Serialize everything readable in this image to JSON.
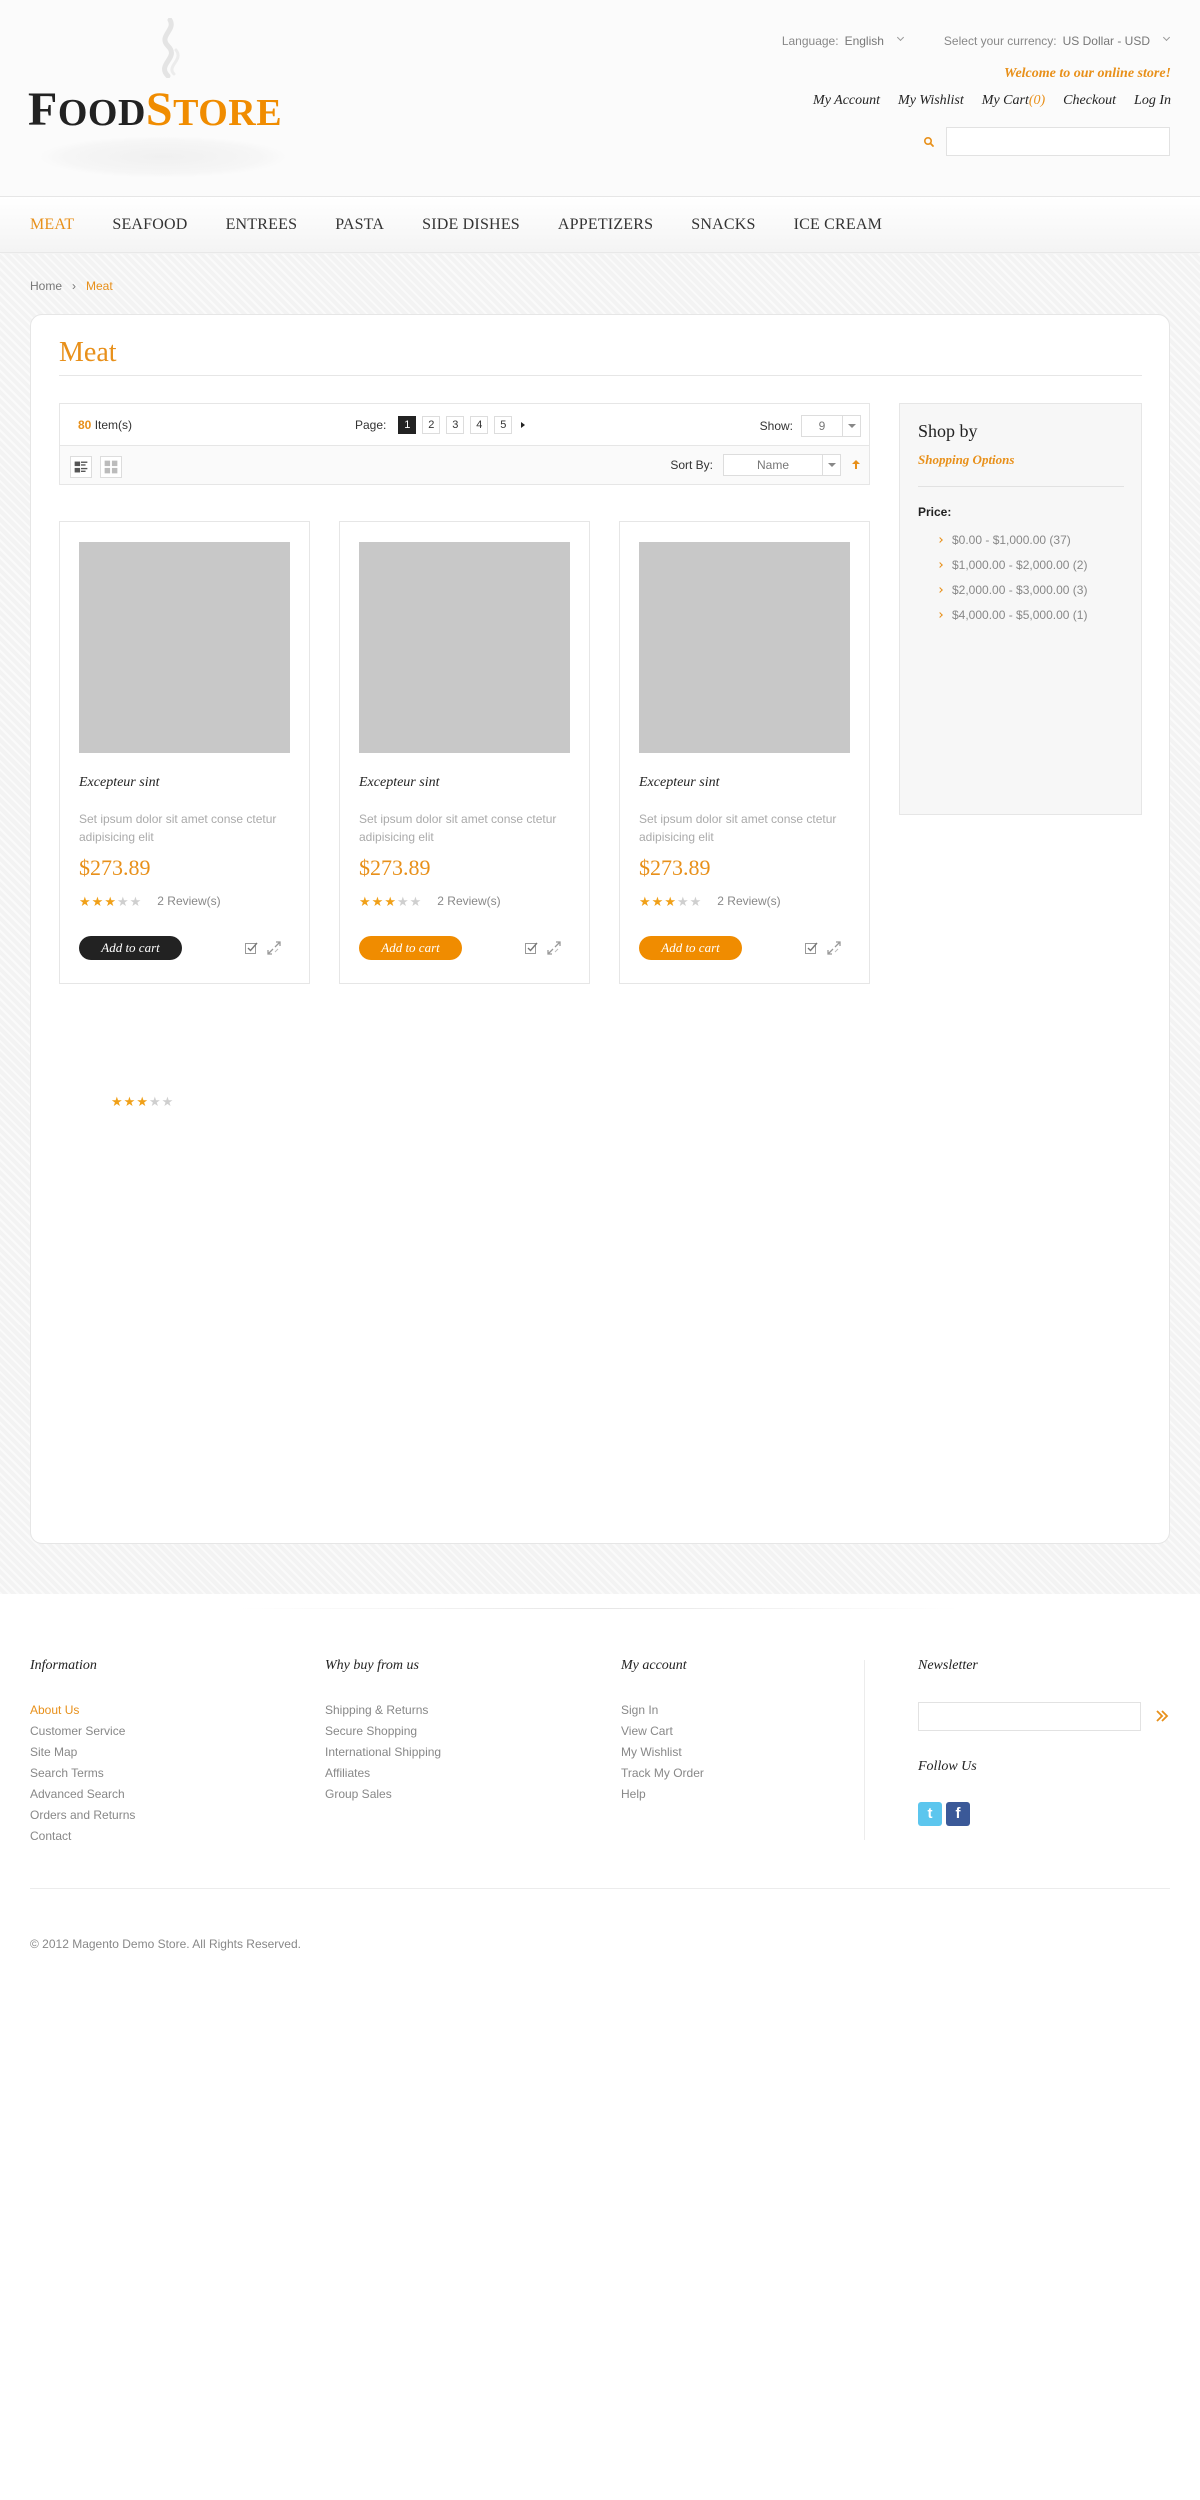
{
  "header": {
    "logo": {
      "text_a": "F",
      "text_b": "OOD",
      "text_c": "S",
      "text_d": "TORE"
    },
    "language": {
      "label": "Language:",
      "value": "English"
    },
    "currency": {
      "label": "Select your currency:",
      "value": "US Dollar - USD"
    },
    "welcome": "Welcome to our online store!",
    "links": {
      "account": "My Account",
      "wishlist": "My Wishlist",
      "cart": "My Cart",
      "cart_count": "(0)",
      "checkout": "Checkout",
      "login": "Log In"
    },
    "search": {
      "value": "",
      "placeholder": ""
    }
  },
  "nav": {
    "items": [
      "Meat",
      "Seafood",
      "Entrees",
      "Pasta",
      "Side Dishes",
      "Appetizers",
      "Snacks",
      "Ice cream"
    ]
  },
  "breadcrumb": {
    "home": "Home",
    "sep": "›",
    "current": "Meat"
  },
  "main": {
    "title": "Meat",
    "toolbar": {
      "count": "80",
      "count_label": "Item(s)",
      "page_label": "Page:",
      "pages": [
        "1",
        "2",
        "3",
        "4",
        "5"
      ],
      "current_page": "1",
      "show_label": "Show:",
      "show_value": "9",
      "sort_label": "Sort By:",
      "sort_value": "Name"
    },
    "products": [
      {
        "name": "Excepteur sint",
        "desc": "Set ipsum dolor sit amet conse ctetur adipisicing elit",
        "price": "$273.89",
        "rating": 3,
        "reviews": "2 Review(s)",
        "cart_label": "Add to cart",
        "cart_style": "dark"
      },
      {
        "name": "Excepteur sint",
        "desc": "Set ipsum dolor sit amet conse ctetur adipisicing elit",
        "price": "$273.89",
        "rating": 3,
        "reviews": "2 Review(s)",
        "cart_label": "Add to cart",
        "cart_style": "orange"
      },
      {
        "name": "Excepteur sint",
        "desc": "Set ipsum dolor sit amet conse ctetur adipisicing elit",
        "price": "$273.89",
        "rating": 3,
        "reviews": "2 Review(s)",
        "cart_label": "Add to cart",
        "cart_style": "orange"
      }
    ],
    "loose_rating": 3
  },
  "sidebar": {
    "heading": "Shop by",
    "subheading": "Shopping Options",
    "price_label": "Price:",
    "price_ranges": [
      "$0.00 - $1,000.00 (37)",
      "$1,000.00 - $2,000.00 (2)",
      "$2,000.00 - $3,000.00 (3)",
      "$4,000.00 - $5,000.00 (1)"
    ]
  },
  "footer": {
    "columns": [
      {
        "heading": "Information",
        "links": [
          "About Us",
          "Customer Service",
          "Site Map",
          "Search Terms",
          "Advanced Search",
          "Orders and Returns",
          "Contact"
        ],
        "highlight": 0
      },
      {
        "heading": "Why buy from us",
        "links": [
          "Shipping & Returns",
          "Secure Shopping",
          "International Shipping",
          "Affiliates",
          "Group Sales"
        ],
        "highlight": -1
      },
      {
        "heading": "My account",
        "links": [
          "Sign In",
          "View Cart",
          "My Wishlist",
          "Track My Order",
          "Help"
        ],
        "highlight": -1
      }
    ],
    "newsletter": {
      "heading": "Newsletter",
      "value": "",
      "follow": "Follow Us",
      "twitter": "t",
      "facebook": "f"
    },
    "copyright": "© 2012 Magento Demo Store. All Rights Reserved."
  },
  "colors": {
    "accent": "#e8901a",
    "dark": "#222222",
    "button_orange": "#f08c00",
    "image_placeholder": "#c8c8c8"
  },
  "icons": [
    "search-icon",
    "caret-down-icon",
    "grid-view-icon",
    "list-view-icon",
    "sort-arrow-icon",
    "wishlist-icon",
    "compare-icon",
    "star-icon",
    "subscribe-arrow-icon",
    "twitter-icon",
    "facebook-icon"
  ]
}
